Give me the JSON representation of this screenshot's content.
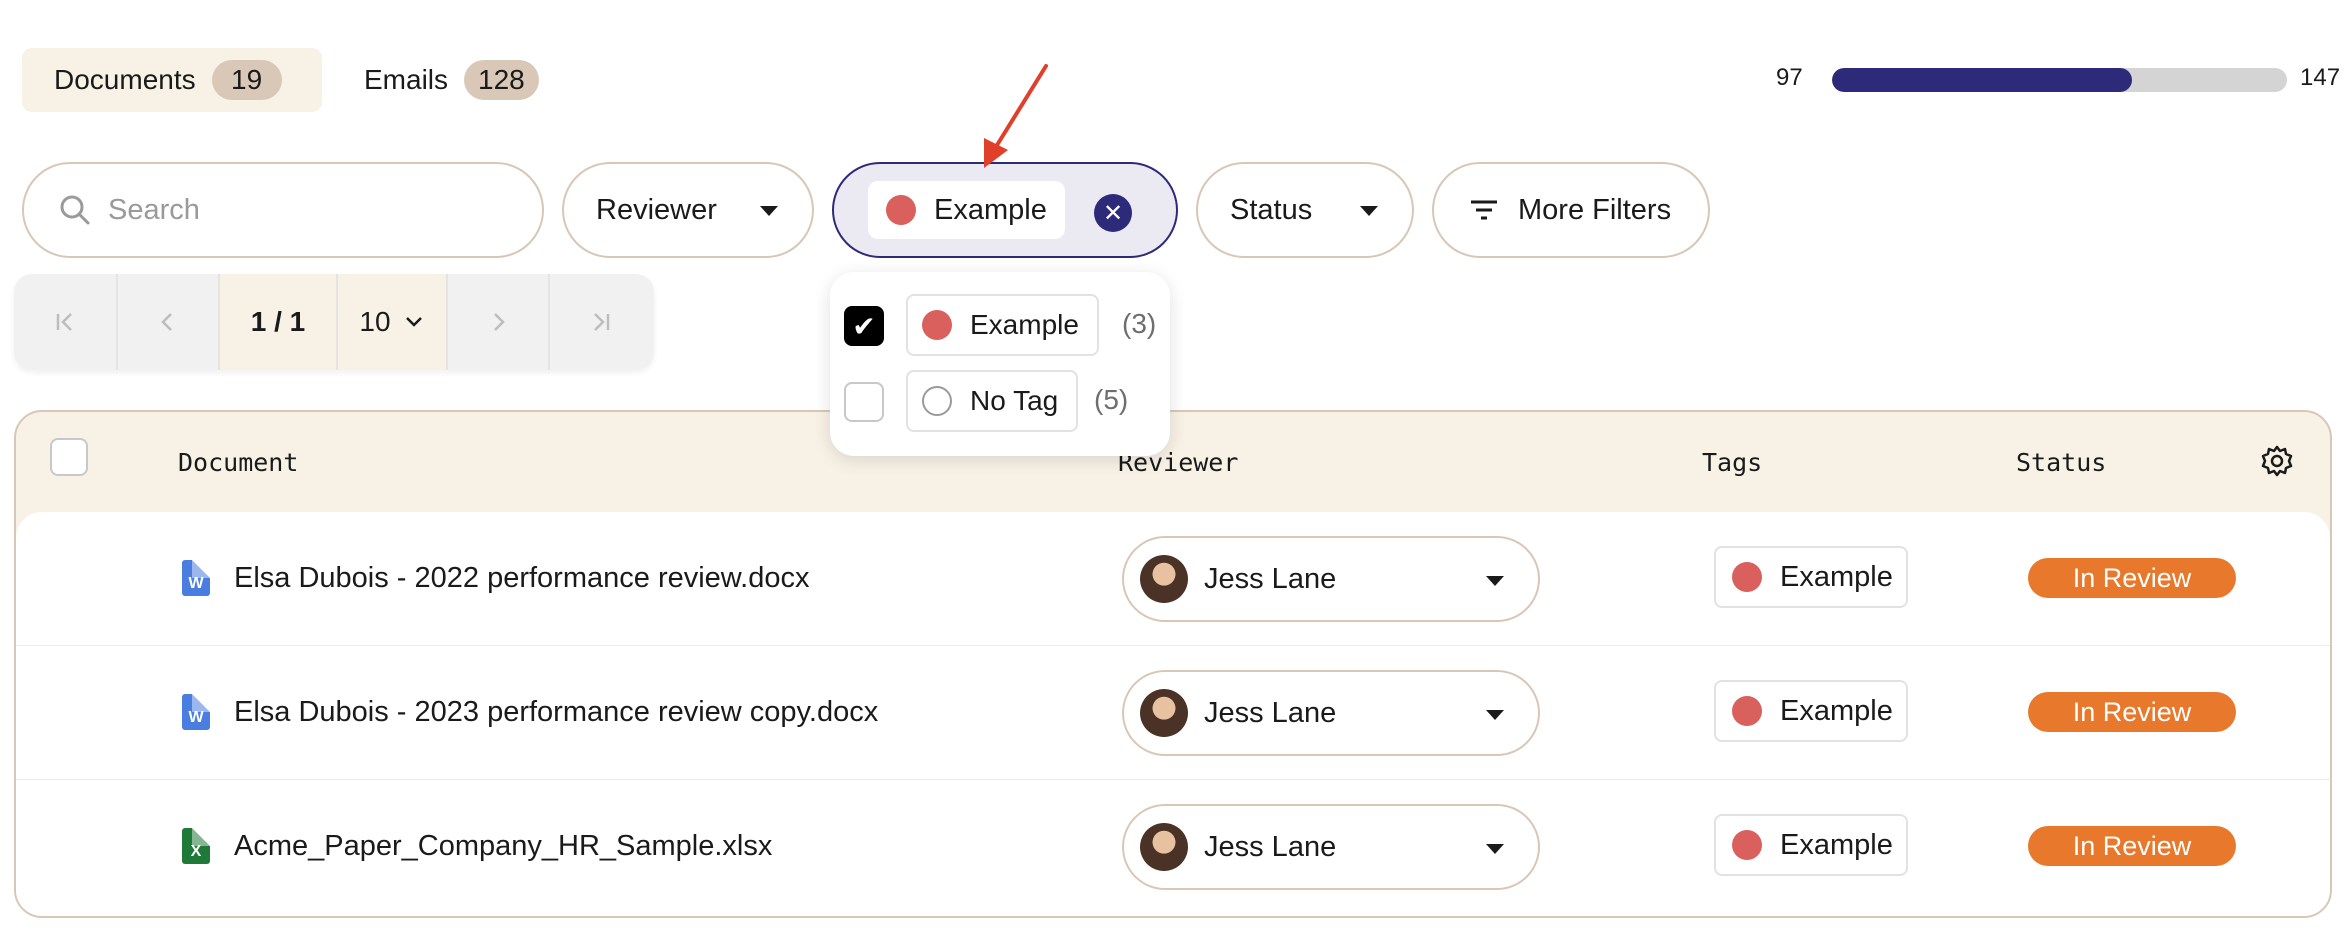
{
  "tabs": [
    {
      "label": "Documents",
      "count": "19"
    },
    {
      "label": "Emails",
      "count": "128"
    }
  ],
  "progress": {
    "min": "97",
    "max": "147",
    "fraction": 0.66
  },
  "filters": {
    "search_placeholder": "Search",
    "reviewer_label": "Reviewer",
    "tag_label": "Example",
    "status_label": "Status",
    "more_label": "More Filters"
  },
  "pager": {
    "pages": "1 / 1",
    "page_size": "10"
  },
  "tag_dropdown": {
    "options": [
      {
        "label": "Example",
        "count": "(3)",
        "checked": true
      },
      {
        "label": "No Tag",
        "count": "(5)",
        "checked": false
      }
    ]
  },
  "table": {
    "headers": {
      "document": "Document",
      "reviewer": "Reviewer",
      "tags": "Tags",
      "status": "Status"
    },
    "rows": [
      {
        "file": "Elsa Dubois - 2022 performance review.docx",
        "type_letter": "W",
        "reviewer": "Jess Lane",
        "tag": "Example",
        "status": "In Review"
      },
      {
        "file": "Elsa Dubois - 2023 performance review copy.docx",
        "type_letter": "W",
        "reviewer": "Jess Lane",
        "tag": "Example",
        "status": "In Review"
      },
      {
        "file": "Acme_Paper_Company_HR_Sample.xlsx",
        "type_letter": "X",
        "reviewer": "Jess Lane",
        "tag": "Example",
        "status": "In Review"
      }
    ]
  },
  "colors": {
    "accent": "#2e2a7a",
    "tag_red": "#d9605c",
    "status_orange": "#e8782b",
    "cream": "#f8f1e6",
    "annotation_arrow": "#e0402a"
  }
}
